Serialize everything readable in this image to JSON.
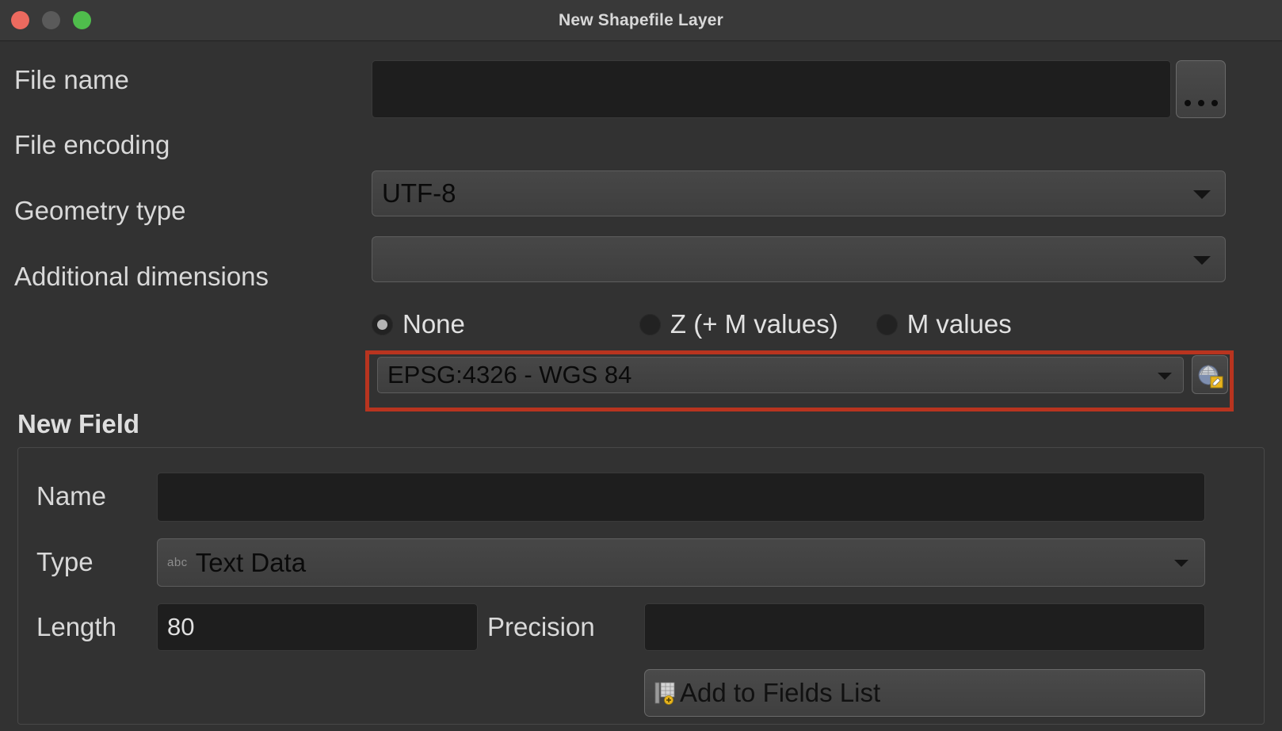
{
  "window": {
    "title": "New Shapefile Layer",
    "controls": [
      {
        "name": "close",
        "color": "#ec6a5f"
      },
      {
        "name": "minimize",
        "color": "#5a5a5a"
      },
      {
        "name": "maximize",
        "color": "#4fbd4c"
      }
    ]
  },
  "form": {
    "file_name": {
      "label": "File name",
      "value": "",
      "placeholder": "",
      "browse_label": "..."
    },
    "file_encoding": {
      "label": "File encoding",
      "value": "UTF-8"
    },
    "geometry_type": {
      "label": "Geometry type",
      "value": ""
    },
    "additional_dimensions": {
      "label": "Additional dimensions",
      "options": [
        {
          "label": "None",
          "selected": true
        },
        {
          "label": "Z (+ M values)",
          "selected": false
        },
        {
          "label": "M values",
          "selected": false
        }
      ]
    },
    "crs": {
      "value": "EPSG:4326 - WGS 84",
      "select_button_icon": "globe-edit-icon",
      "highlight_color": "#b8341f"
    }
  },
  "new_field": {
    "section_title": "New Field",
    "name": {
      "label": "Name",
      "value": "",
      "placeholder": ""
    },
    "type": {
      "label": "Type",
      "icon": "abc",
      "value": "Text Data"
    },
    "length": {
      "label": "Length",
      "value": "80"
    },
    "precision": {
      "label": "Precision",
      "value": ""
    },
    "add_button": {
      "label": "Add to Fields List",
      "icon": "add-field-icon"
    }
  }
}
